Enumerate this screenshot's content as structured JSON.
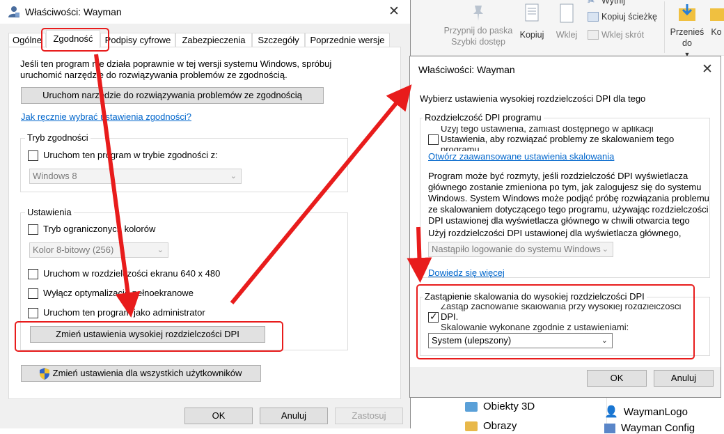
{
  "explorer": {
    "ribbon": {
      "pin_label": "Przypnij do paska Szybki dostęp",
      "copy_label": "Kopiuj",
      "paste_label": "Wklej",
      "cut_label": "Wytnij",
      "copy_path_label": "Kopiuj ścieżkę",
      "paste_shortcut_label": "Wklej skrót",
      "move_label": "Przenieś do",
      "copy_to_label": "Ko"
    },
    "nav": {
      "folder_1": "Obiekty 3D",
      "folder_2": "Obrazy"
    },
    "files": {
      "item_1": "WaymanLogo",
      "item_2": "Wayman Config"
    }
  },
  "left_dialog": {
    "title": "Właściwości: Wayman",
    "tabs": [
      "Ogólne",
      "Zgodność",
      "Podpisy cyfrowe",
      "Zabezpieczenia",
      "Szczegóły",
      "Poprzednie wersje"
    ],
    "intro": "Jeśli ten program nie działa poprawnie w tej wersji systemu Windows, spróbuj uruchomić narzędzie do rozwiązywania problemów ze zgodnością.",
    "troubleshooter_button": "Uruchom narzędzie do rozwiązywania problemów ze zgodnością",
    "manual_link": "Jak ręcznie wybrać ustawienia zgodności?",
    "compat_group": {
      "title": "Tryb zgodności",
      "checkbox": "Uruchom ten program w trybie zgodności z:",
      "select_value": "Windows 8"
    },
    "settings_group": {
      "title": "Ustawienia",
      "reduced_color": "Tryb ograniczonych kolorów",
      "color_select": "Kolor 8-bitowy (256)",
      "res_640": "Uruchom w rozdzielczości ekranu 640 x 480",
      "disable_fullscreen": "Wyłącz optymalizacje pełnoekranowe",
      "run_admin": "Uruchom ten program jako administrator",
      "dpi_button": "Zmień ustawienia wysokiej rozdzielczości DPI"
    },
    "all_users_button": "Zmień ustawienia dla wszystkich użytkowników",
    "ok": "OK",
    "cancel": "Anuluj",
    "apply": "Zastosuj"
  },
  "right_dialog": {
    "title": "Właściwości: Wayman",
    "heading": "Wybierz ustawienia wysokiej rozdzielczości DPI dla tego",
    "program_dpi_group": {
      "title": "Rozdzielczość DPI programu",
      "cut_line": "Użyj tego ustawienia, zamiast dostępnego w aplikacji",
      "checkbox_line1": "Ustawienia, aby rozwiązać problemy ze skalowaniem tego",
      "checkbox_line2_cut": "programu",
      "advanced_link": "Otwórz zaawansowane ustawienia skalowania",
      "blur_text_1": "Program może być rozmyty, jeśli rozdzielczość DPI wyświetlacza",
      "blur_text_2": "głównego zostanie zmieniona po tym, jak zalogujesz się do systemu",
      "blur_text_3": "Windows. System Windows może podjąć próbę rozwiązania problemu",
      "blur_text_4": "ze skalowaniem dotyczącego tego programu, używając rozdzielczości",
      "blur_text_5": "DPI ustawionej dla wyświetlacza głównego w chwili otwarcia tego",
      "use_dpi_label": "Użyj rozdzielczości DPI ustawionej dla wyświetlacza głównego,",
      "use_dpi_select": "Nastąpiło logowanie do systemu Windows",
      "learn_more": "Dowiedz się więcej"
    },
    "override_group": {
      "title": "Zastąpienie skalowania do wysokiej rozdzielczości DPI",
      "cut_line": "Zastąp zachowanie skalowania przy wysokiej rozdzielczości",
      "checkbox_label": "DPI.",
      "cut_line_2": "Skalowanie wykonane zgodnie z ustawieniami:",
      "select_value": "System (ulepszony)"
    },
    "ok": "OK",
    "cancel": "Anuluj"
  },
  "annotation_color": "#e81c1c"
}
